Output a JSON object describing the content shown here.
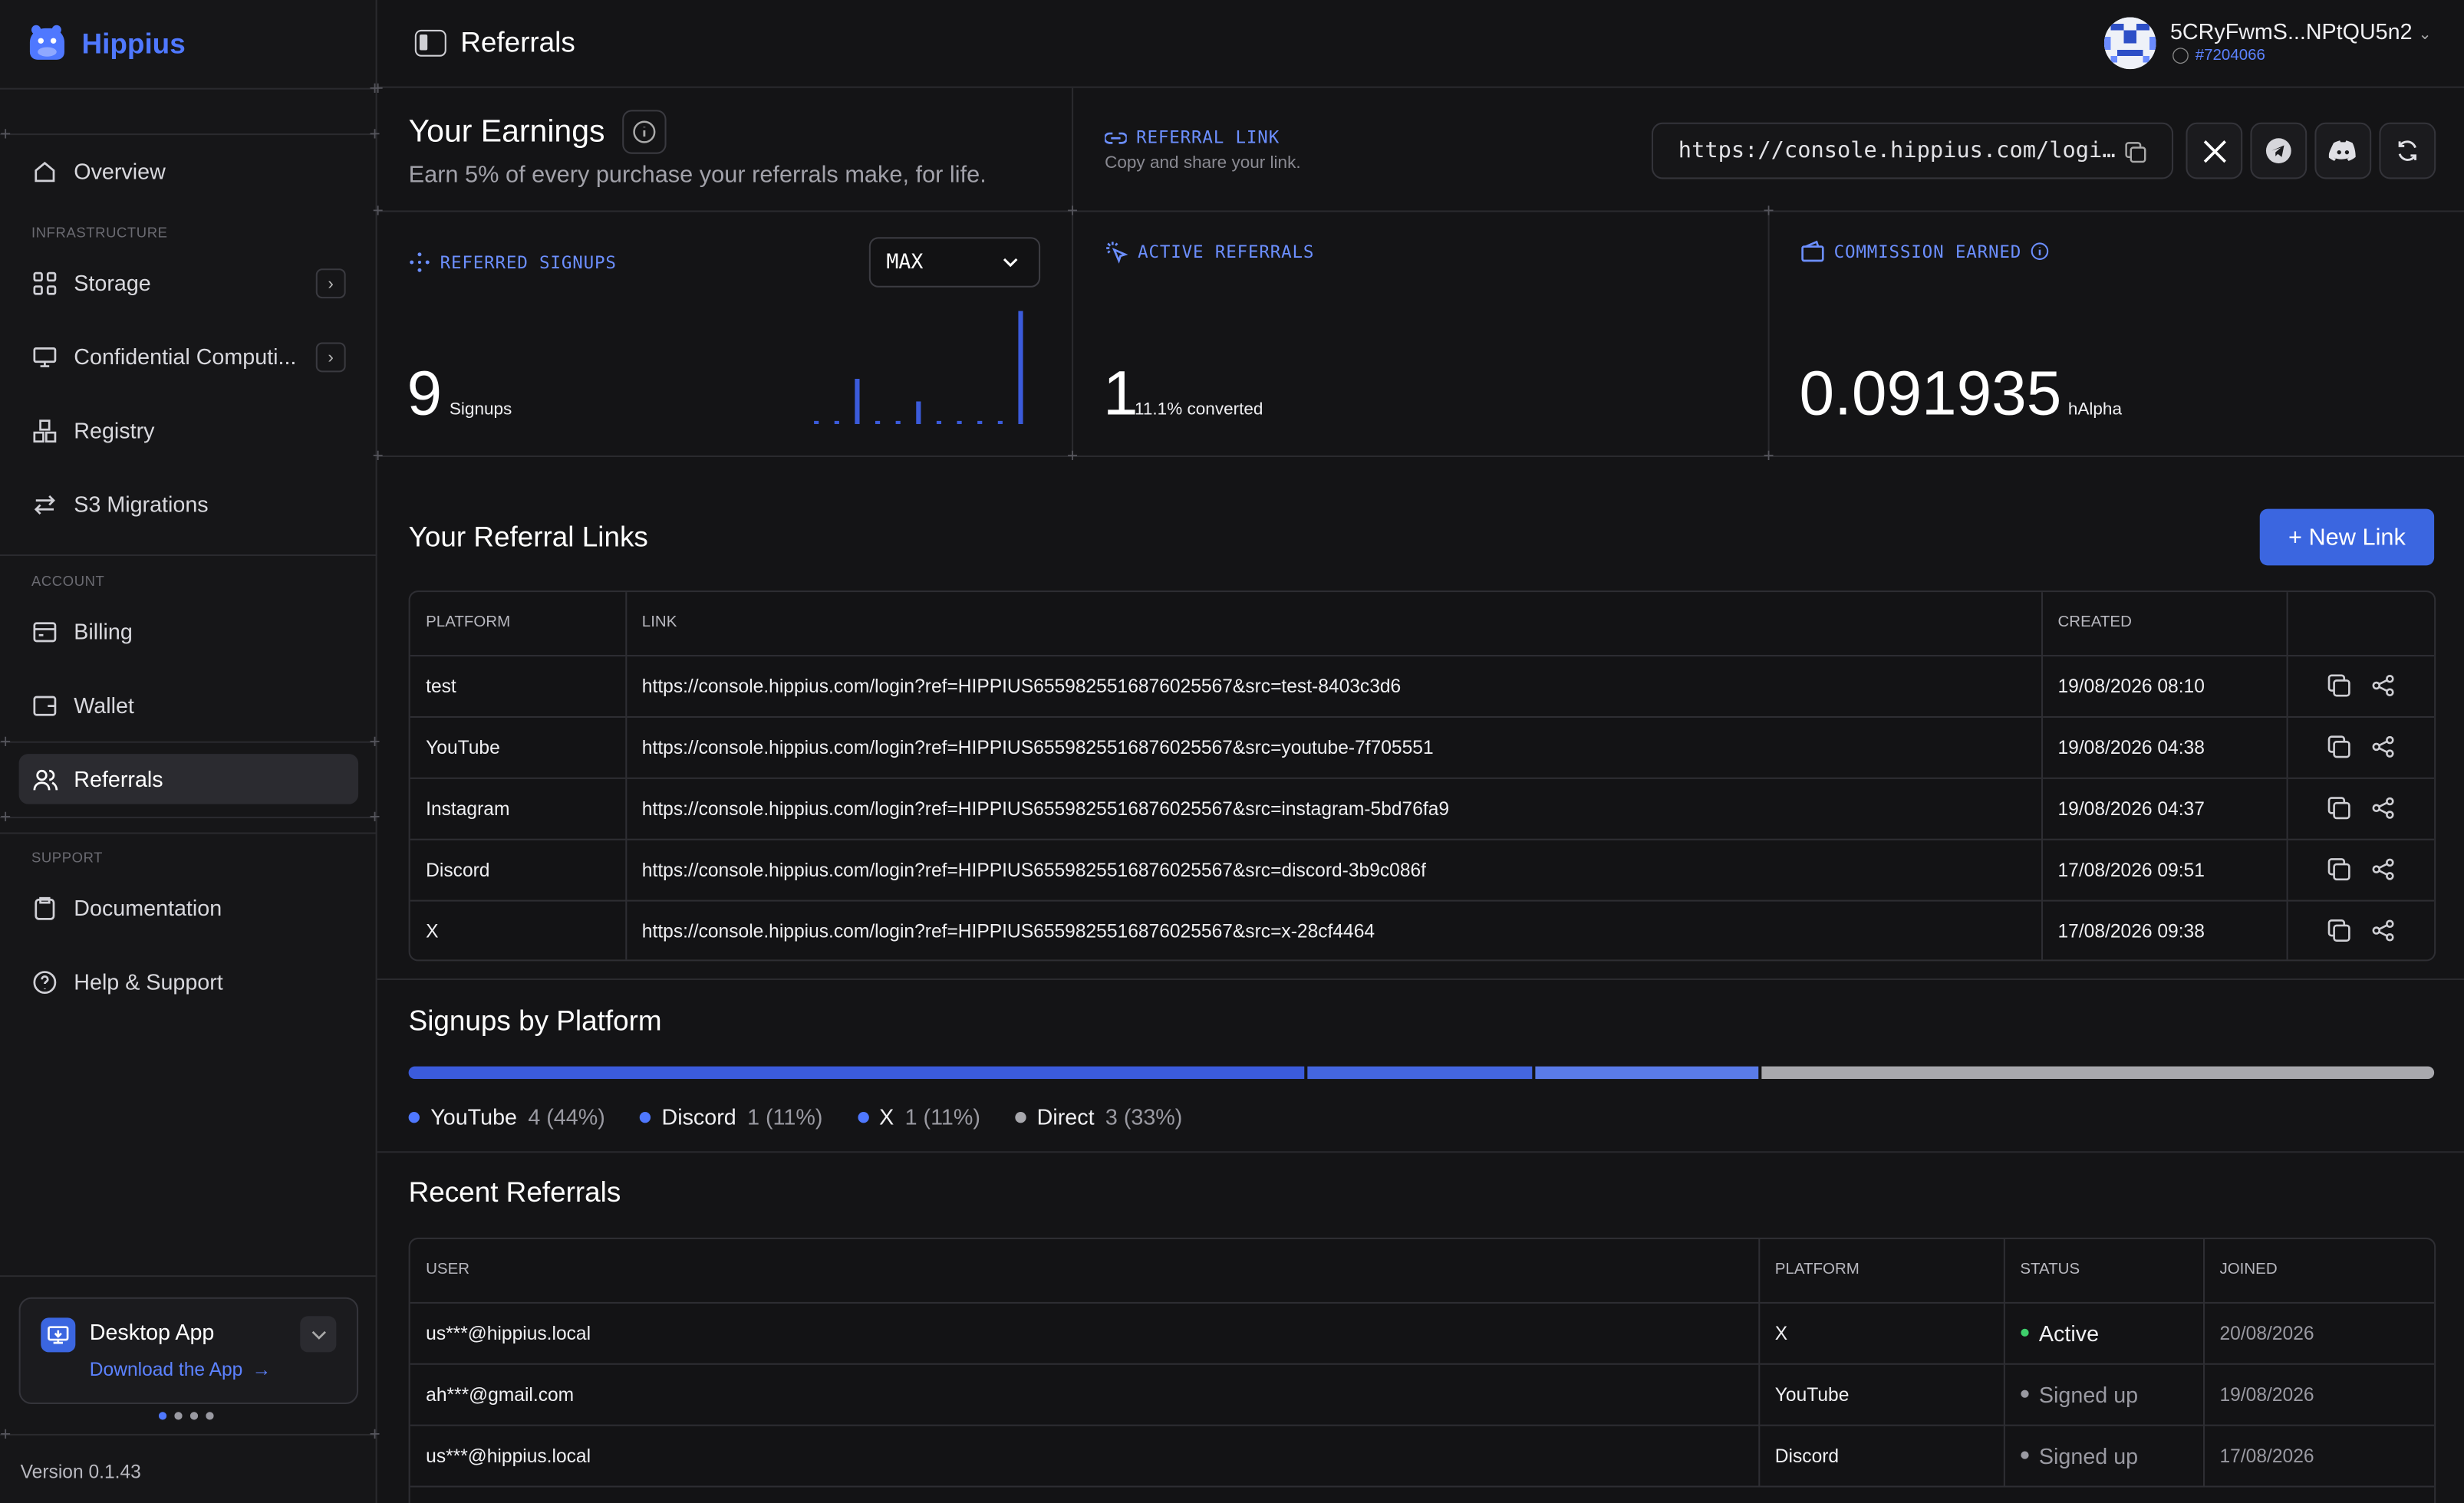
{
  "app": {
    "name": "Hippius"
  },
  "header": {
    "title": "Referrals",
    "account_name": "5CRyFwmS...NPtQU5n2",
    "account_id": "#7204066"
  },
  "sidebar": {
    "items": [
      {
        "label": "Overview"
      },
      {
        "label": "Storage"
      },
      {
        "label": "Confidential Computi..."
      },
      {
        "label": "Registry"
      },
      {
        "label": "S3 Migrations"
      },
      {
        "label": "Billing"
      },
      {
        "label": "Wallet"
      },
      {
        "label": "Referrals"
      },
      {
        "label": "Documentation"
      },
      {
        "label": "Help & Support"
      }
    ],
    "sections": {
      "infrastructure": "INFRASTRUCTURE",
      "account": "ACCOUNT",
      "support": "SUPPORT"
    },
    "desktop_app": {
      "title": "Desktop App",
      "link": "Download the App"
    },
    "version": "Version 0.1.43"
  },
  "earnings": {
    "title": "Your Earnings",
    "subtitle": "Earn 5% of every purchase your referrals make, for life."
  },
  "referral_link": {
    "label": "REFERRAL LINK",
    "hint": "Copy and share your link.",
    "url": "https://console.hippius.com/logi…"
  },
  "stats": {
    "signups": {
      "label": "REFERRED SIGNUPS",
      "value": "9",
      "unit": "Signups",
      "range": "MAX",
      "sparkline": [
        0,
        0,
        4,
        0,
        0,
        2,
        0,
        0,
        0,
        0,
        10
      ]
    },
    "active": {
      "label": "ACTIVE REFERRALS",
      "value": "1",
      "unit": "11.1% converted"
    },
    "commission": {
      "label": "COMMISSION EARNED",
      "value": "0.091935",
      "unit": "hAlpha"
    }
  },
  "links": {
    "title": "Your Referral Links",
    "new_button": "+ New Link",
    "columns": {
      "platform": "PLATFORM",
      "link": "LINK",
      "created": "CREATED"
    },
    "rows": [
      {
        "platform": "test",
        "link": "https://console.hippius.com/login?ref=HIPPIUS6559825516876025567&src=test-8403c3d6",
        "created": "19/08/2026 08:10"
      },
      {
        "platform": "YouTube",
        "link": "https://console.hippius.com/login?ref=HIPPIUS6559825516876025567&src=youtube-7f705551",
        "created": "19/08/2026 04:38"
      },
      {
        "platform": "Instagram",
        "link": "https://console.hippius.com/login?ref=HIPPIUS6559825516876025567&src=instagram-5bd76fa9",
        "created": "19/08/2026 04:37"
      },
      {
        "platform": "Discord",
        "link": "https://console.hippius.com/login?ref=HIPPIUS6559825516876025567&src=discord-3b9c086f",
        "created": "17/08/2026 09:51"
      },
      {
        "platform": "X",
        "link": "https://console.hippius.com/login?ref=HIPPIUS6559825516876025567&src=x-28cf4464",
        "created": "17/08/2026 09:38"
      }
    ]
  },
  "platforms": {
    "title": "Signups by Platform",
    "items": [
      {
        "name": "YouTube",
        "value": "4 (44%)",
        "share": 0.444,
        "color": "#3b5bdb"
      },
      {
        "name": "Discord",
        "value": "1 (11%)",
        "share": 0.111,
        "color": "#4466e0"
      },
      {
        "name": "X",
        "value": "1 (11%)",
        "share": 0.111,
        "color": "#5a7be8"
      },
      {
        "name": "Direct",
        "value": "3 (33%)",
        "share": 0.333,
        "color": "#a8a8ad"
      }
    ]
  },
  "recent": {
    "title": "Recent Referrals",
    "columns": {
      "user": "USER",
      "platform": "PLATFORM",
      "status": "STATUS",
      "joined": "JOINED"
    },
    "rows": [
      {
        "user": "us***@hippius.local",
        "platform": "X",
        "status": "Active",
        "joined": "20/08/2026",
        "status_color": "#3ecf6b"
      },
      {
        "user": "ah***@gmail.com",
        "platform": "YouTube",
        "status": "Signed up",
        "joined": "19/08/2026",
        "status_color": "#9a9aa2"
      },
      {
        "user": "us***@hippius.local",
        "platform": "Discord",
        "status": "Signed up",
        "joined": "17/08/2026",
        "status_color": "#9a9aa2"
      }
    ]
  }
}
